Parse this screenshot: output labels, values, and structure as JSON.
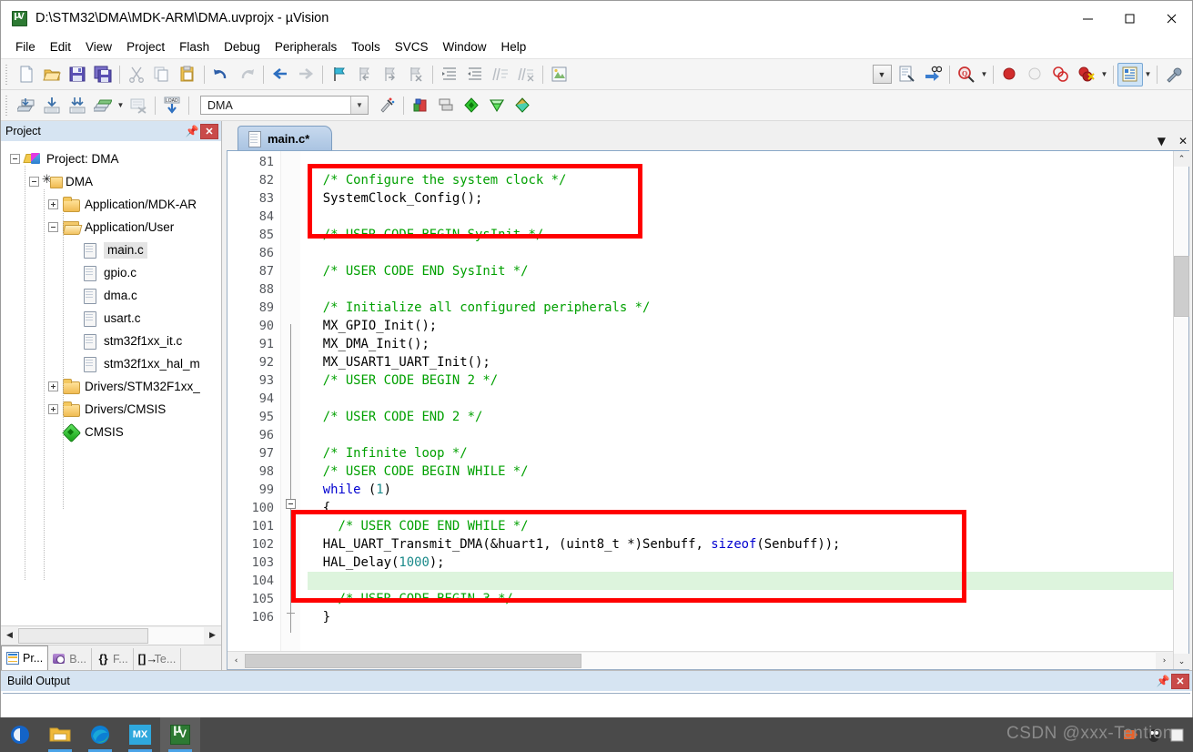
{
  "window": {
    "title": "D:\\STM32\\DMA\\MDK-ARM\\DMA.uvprojx - µVision",
    "app_icon": "uvision-icon",
    "minimize": "—",
    "maximize": "□",
    "close": "✕"
  },
  "menu": {
    "items": [
      {
        "label": "File"
      },
      {
        "label": "Edit"
      },
      {
        "label": "View"
      },
      {
        "label": "Project"
      },
      {
        "label": "Flash"
      },
      {
        "label": "Debug"
      },
      {
        "label": "Peripherals"
      },
      {
        "label": "Tools"
      },
      {
        "label": "SVCS"
      },
      {
        "label": "Window"
      },
      {
        "label": "Help"
      }
    ]
  },
  "toolbar_main": {
    "buttons": [
      {
        "name": "new-file-icon",
        "glyph": "🗋"
      },
      {
        "name": "open-file-icon",
        "glyph": "📂"
      },
      {
        "name": "save-icon",
        "glyph": "💾"
      },
      {
        "name": "save-all-icon",
        "glyph": "🖫"
      },
      {
        "name": "cut-icon",
        "glyph": "✂"
      },
      {
        "name": "copy-icon",
        "glyph": "⧉"
      },
      {
        "name": "paste-icon",
        "glyph": "📋"
      },
      {
        "name": "undo-icon",
        "glyph": "↶"
      },
      {
        "name": "redo-icon",
        "glyph": "↷"
      },
      {
        "name": "navigate-back-icon",
        "glyph": "←"
      },
      {
        "name": "navigate-forward-icon",
        "glyph": "→"
      },
      {
        "name": "bookmark-toggle-icon",
        "glyph": "⚑"
      },
      {
        "name": "bookmark-prev-icon",
        "glyph": "⚑"
      },
      {
        "name": "bookmark-next-icon",
        "glyph": "⚑"
      },
      {
        "name": "bookmark-clear-icon",
        "glyph": "⚑"
      },
      {
        "name": "indent-icon",
        "glyph": "≡"
      },
      {
        "name": "outdent-icon",
        "glyph": "≡"
      },
      {
        "name": "comment-icon",
        "glyph": "⫽"
      },
      {
        "name": "uncomment-icon",
        "glyph": "⫽"
      },
      {
        "name": "insert-file-icon",
        "glyph": "🗎"
      }
    ],
    "right_buttons": [
      {
        "name": "dropdown-toggle-icon",
        "glyph": "⌄"
      },
      {
        "name": "source-browse-icon",
        "glyph": "🗎"
      },
      {
        "name": "find-in-files-icon",
        "glyph": "🔎"
      },
      {
        "name": "find-icon",
        "glyph": "🔍"
      },
      {
        "name": "insert-breakpoint-icon",
        "glyph": "●"
      },
      {
        "name": "disable-breakpoint-icon",
        "glyph": "○"
      },
      {
        "name": "disable-all-breakpoints-icon",
        "glyph": "◌"
      },
      {
        "name": "kill-all-breakpoints-icon",
        "glyph": "●"
      },
      {
        "name": "manage-windows-icon",
        "glyph": "▤"
      },
      {
        "name": "configure-icon",
        "glyph": "🔧"
      }
    ]
  },
  "toolbar_build": {
    "buttons": [
      {
        "name": "translate-icon",
        "glyph": "⬇"
      },
      {
        "name": "build-icon",
        "glyph": "⬇"
      },
      {
        "name": "rebuild-icon",
        "glyph": "⬇"
      },
      {
        "name": "batch-build-icon",
        "glyph": "⬇"
      },
      {
        "name": "stop-build-icon",
        "glyph": "✖"
      },
      {
        "name": "download-icon",
        "glyph": "LOAD"
      }
    ],
    "target_value": "DMA",
    "after_buttons": [
      {
        "name": "select-target-icon",
        "glyph": "⌄"
      },
      {
        "name": "target-options-icon",
        "glyph": "⚒"
      },
      {
        "name": "manage-project-items-icon",
        "glyph": "■"
      },
      {
        "name": "manage-multi-project-icon",
        "glyph": "▣"
      },
      {
        "name": "pack-installer-icon",
        "glyph": "◆"
      },
      {
        "name": "run-time-env-icon",
        "glyph": "◆"
      },
      {
        "name": "pack-manage-icon",
        "glyph": "◆"
      }
    ]
  },
  "project_panel": {
    "title": "Project",
    "pin_icon": "pin-icon",
    "close_label": "✕",
    "tree": [
      {
        "label": "Project: DMA",
        "depth": 0,
        "icon": "project",
        "expander": "minus",
        "selected": false
      },
      {
        "label": "DMA",
        "depth": 1,
        "icon": "target",
        "expander": "minus",
        "selected": false
      },
      {
        "label": "Application/MDK-AR",
        "depth": 2,
        "icon": "folder",
        "expander": "plus",
        "selected": false
      },
      {
        "label": "Application/User",
        "depth": 2,
        "icon": "folder-open",
        "expander": "minus",
        "selected": false
      },
      {
        "label": "main.c",
        "depth": 3,
        "icon": "cfile",
        "expander": "none",
        "selected": true
      },
      {
        "label": "gpio.c",
        "depth": 3,
        "icon": "cfile",
        "expander": "none",
        "selected": false
      },
      {
        "label": "dma.c",
        "depth": 3,
        "icon": "cfile",
        "expander": "none",
        "selected": false
      },
      {
        "label": "usart.c",
        "depth": 3,
        "icon": "cfile",
        "expander": "none",
        "selected": false
      },
      {
        "label": "stm32f1xx_it.c",
        "depth": 3,
        "icon": "cfile",
        "expander": "none",
        "selected": false
      },
      {
        "label": "stm32f1xx_hal_m",
        "depth": 3,
        "icon": "cfile",
        "expander": "none",
        "selected": false
      },
      {
        "label": "Drivers/STM32F1xx_",
        "depth": 2,
        "icon": "folder",
        "expander": "plus",
        "selected": false
      },
      {
        "label": "Drivers/CMSIS",
        "depth": 2,
        "icon": "folder",
        "expander": "plus",
        "selected": false
      },
      {
        "label": "CMSIS",
        "depth": 2,
        "icon": "cmsis",
        "expander": "none",
        "selected": false
      }
    ],
    "scroll_left": "◀",
    "scroll_right": "▶",
    "tabs": [
      {
        "label": "Pr...",
        "icon": "project-tab-icon",
        "active": true
      },
      {
        "label": "B...",
        "icon": "books-tab-icon",
        "active": false
      },
      {
        "label": "F...",
        "icon": "functions-tab-icon",
        "glyph": "{}",
        "active": false
      },
      {
        "label": "Te...",
        "icon": "templates-tab-icon",
        "glyph": "[]→",
        "active": false
      }
    ]
  },
  "editor": {
    "tab": {
      "label": "main.c*",
      "icon": "c-file-icon"
    },
    "tabstrip_menu": "▼",
    "tabstrip_close": "✕",
    "first_line_number": 81,
    "lines": [
      {
        "n": 81,
        "tokens": []
      },
      {
        "n": 82,
        "tokens": [
          {
            "t": "  /* Configure the system clock */",
            "c": "cmt"
          }
        ]
      },
      {
        "n": 83,
        "tokens": [
          {
            "t": "  SystemClock_Config();",
            "c": ""
          }
        ]
      },
      {
        "n": 84,
        "tokens": []
      },
      {
        "n": 85,
        "tokens": [
          {
            "t": "  /* USER CODE BEGIN SysInit */",
            "c": "cmt"
          }
        ]
      },
      {
        "n": 86,
        "tokens": []
      },
      {
        "n": 87,
        "tokens": [
          {
            "t": "  /* USER CODE END SysInit */",
            "c": "cmt"
          }
        ]
      },
      {
        "n": 88,
        "tokens": []
      },
      {
        "n": 89,
        "tokens": [
          {
            "t": "  /* Initialize all configured peripherals */",
            "c": "cmt"
          }
        ]
      },
      {
        "n": 90,
        "tokens": [
          {
            "t": "  MX_GPIO_Init();",
            "c": ""
          }
        ]
      },
      {
        "n": 91,
        "tokens": [
          {
            "t": "  MX_DMA_Init();",
            "c": ""
          }
        ]
      },
      {
        "n": 92,
        "tokens": [
          {
            "t": "  MX_USART1_UART_Init();",
            "c": ""
          }
        ]
      },
      {
        "n": 93,
        "tokens": [
          {
            "t": "  /* USER CODE BEGIN 2 */",
            "c": "cmt"
          }
        ]
      },
      {
        "n": 94,
        "tokens": []
      },
      {
        "n": 95,
        "tokens": [
          {
            "t": "  /* USER CODE END 2 */",
            "c": "cmt"
          }
        ]
      },
      {
        "n": 96,
        "tokens": []
      },
      {
        "n": 97,
        "tokens": [
          {
            "t": "  /* Infinite loop */",
            "c": "cmt"
          }
        ]
      },
      {
        "n": 98,
        "tokens": [
          {
            "t": "  /* USER CODE BEGIN WHILE */",
            "c": "cmt"
          }
        ]
      },
      {
        "n": 99,
        "tokens": [
          {
            "t": "  ",
            "c": ""
          },
          {
            "t": "while",
            "c": "kw"
          },
          {
            "t": " (",
            "c": ""
          },
          {
            "t": "1",
            "c": "num"
          },
          {
            "t": ")",
            "c": ""
          }
        ]
      },
      {
        "n": 100,
        "tokens": [
          {
            "t": "  {",
            "c": ""
          }
        ]
      },
      {
        "n": 101,
        "tokens": [
          {
            "t": "    /* USER CODE END WHILE */",
            "c": "cmt"
          }
        ]
      },
      {
        "n": 102,
        "tokens": [
          {
            "t": "  HAL_UART_Transmit_DMA(&huart1, (uint8_t *)Senbuff, ",
            "c": ""
          },
          {
            "t": "sizeof",
            "c": "kw"
          },
          {
            "t": "(Senbuff));",
            "c": ""
          }
        ]
      },
      {
        "n": 103,
        "tokens": [
          {
            "t": "  HAL_Delay(",
            "c": ""
          },
          {
            "t": "1000",
            "c": "num"
          },
          {
            "t": ");",
            "c": ""
          }
        ]
      },
      {
        "n": 104,
        "tokens": [],
        "current": true
      },
      {
        "n": 105,
        "tokens": [
          {
            "t": "    /* USER CODE BEGIN 3 */",
            "c": "cmt"
          }
        ]
      },
      {
        "n": 106,
        "tokens": [
          {
            "t": "  }",
            "c": ""
          }
        ]
      }
    ],
    "annotations": [
      {
        "name": "highlight-box-systemclock",
        "color": "#ff0000"
      },
      {
        "name": "highlight-box-uart-transmit",
        "color": "#ff0000"
      }
    ],
    "scroll_up": "⌃",
    "scroll_down": "⌄",
    "scroll_left": "‹",
    "scroll_right": "›"
  },
  "build_output": {
    "title": "Build Output",
    "pin_icon": "pin-icon",
    "close_label": "✕",
    "content": ""
  },
  "taskbar": {
    "start": "start-button",
    "items": [
      {
        "name": "file-explorer",
        "active": false
      },
      {
        "name": "microsoft-edge",
        "active": false
      },
      {
        "name": "stm32cubemx",
        "label": "MX",
        "active": false
      },
      {
        "name": "keil-uvision",
        "active": true
      }
    ],
    "watermark": "CSDN @xxx-Tention",
    "tray": [
      {
        "name": "tray-icon-1"
      },
      {
        "name": "tray-icon-2"
      },
      {
        "name": "tray-icon-3"
      }
    ]
  },
  "colors": {
    "accent": "#d6e4f2",
    "annotation": "#ff0000",
    "comment": "#00a000",
    "keyword": "#0000d0",
    "number": "#1a8a8a",
    "current_line": "#ddf4dd"
  }
}
